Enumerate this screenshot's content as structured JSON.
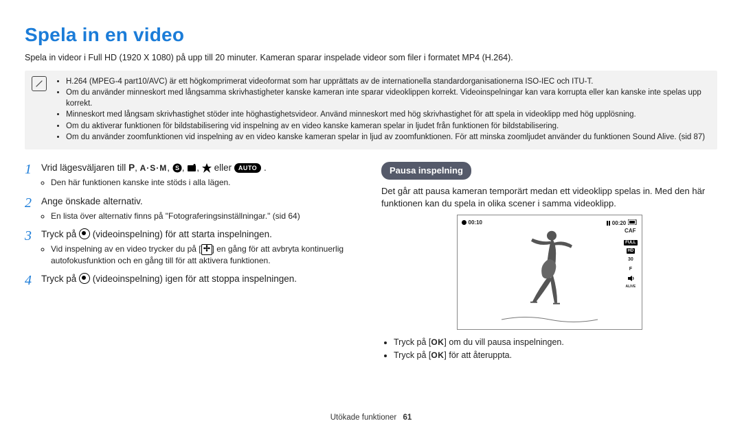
{
  "title": "Spela in en video",
  "intro": "Spela in videor i Full HD (1920 X 1080) på upp till 20 minuter. Kameran sparar inspelade videor som filer i formatet MP4 (H.264).",
  "note_bullets": [
    "H.264 (MPEG-4 part10/AVC) är ett högkomprimerat videoformat som har upprättats av de internationella standardorganisationerna ISO-IEC och ITU-T.",
    "Om du använder minneskort med långsamma skrivhastigheter kanske kameran inte sparar videoklippen korrekt. Videoinspelningar kan vara korrupta eller kan kanske inte spelas upp korrekt.",
    "Minneskort med långsam skrivhastighet stöder inte höghastighetsvideor. Använd minneskort med hög skrivhastighet för att spela in videoklipp med hög upplösning.",
    "Om du aktiverar funktionen för bildstabilisering vid inspelning av en video kanske kameran spelar in ljudet från funktionen för bildstabilisering.",
    "Om du använder zoomfunktionen vid inspelning av en video kanske kameran spelar in ljud av zoomfunktionen. För att minska zoomljudet använder du funktionen Sound Alive. (sid 87)"
  ],
  "steps": {
    "s1_prefix": "Vrid lägesväljaren till ",
    "s1_mid": " eller ",
    "s1_end": ".",
    "s1_sub": "Den här funktionen kanske inte stöds i alla lägen.",
    "s2": "Ange önskade alternativ.",
    "s2_sub": "En lista över alternativ finns på \"Fotograferingsinställningar.\" (sid 64)",
    "s3_a": "Tryck på ",
    "s3_b": " (videoinspelning) för att starta inspelningen.",
    "s3_sub_a": "Vid inspelning av en video trycker du på [",
    "s3_sub_b": "] en gång för att avbryta kontinuerlig autofokusfunktion och en gång till för att aktivera funktionen.",
    "s4_a": "Tryck på ",
    "s4_b": " (videoinspelning) igen för att stoppa inspelningen."
  },
  "modes": {
    "p": "P",
    "asm": "A·S·M",
    "auto": "AUTO"
  },
  "right": {
    "pause_title": "Pausa inspelning",
    "pause_body": "Det går att pausa kameran temporärt medan ett videoklipp spelas in. Med den här funktionen kan du spela in olika scener i samma videoklipp.",
    "b1_a": "Tryck på [",
    "b1_b": "] om du vill pausa inspelningen.",
    "b2_a": "Tryck på [",
    "b2_b": "] för att återuppta."
  },
  "screen": {
    "rec_time": "00:10",
    "remain_time": "00:20",
    "caf": "CAF",
    "full": "FULL",
    "hd": "HD",
    "thirty": "30",
    "f": "F",
    "alive": "ALIVE"
  },
  "footer_label": "Utökade funktioner",
  "footer_page": "61"
}
